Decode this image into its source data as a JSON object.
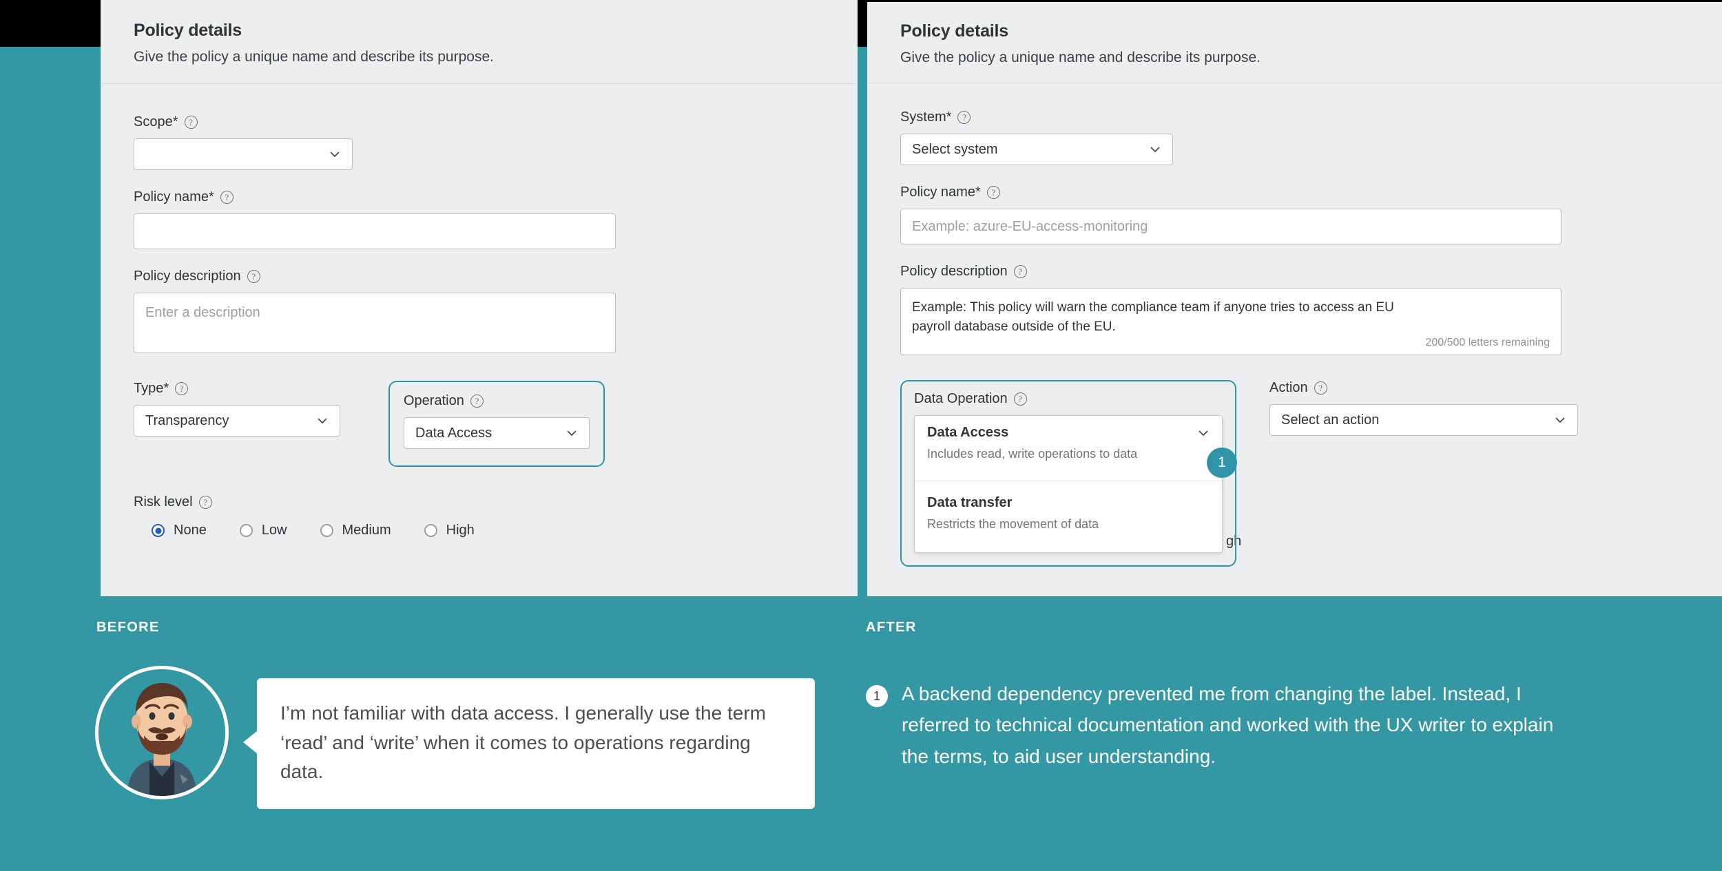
{
  "theme": {
    "background_teal": "#3498a4",
    "panel_bg": "#eceef0",
    "highlight_border": "#2f94a8",
    "radio_accent": "#1f5fbf"
  },
  "before_panel": {
    "title": "Policy details",
    "subtitle": "Give the policy a unique name and describe its purpose.",
    "scope": {
      "label": "Scope*",
      "value": ""
    },
    "policy_name": {
      "label": "Policy name*",
      "value": ""
    },
    "policy_description": {
      "label": "Policy description",
      "placeholder": "Enter a description"
    },
    "type": {
      "label": "Type*",
      "value": "Transparency"
    },
    "operation": {
      "label": "Operation",
      "value": "Data Access"
    },
    "risk_level": {
      "label": "Risk level",
      "options": [
        "None",
        "Low",
        "Medium",
        "High"
      ],
      "selected": "None"
    }
  },
  "after_panel": {
    "title": "Policy details",
    "subtitle": "Give the policy a unique name and describe its purpose.",
    "system": {
      "label": "System*",
      "value": "Select system"
    },
    "policy_name": {
      "label": "Policy name*",
      "placeholder": "Example: azure-EU-access-monitoring"
    },
    "policy_description": {
      "label": "Policy description",
      "placeholder_line1": "Example: This policy will warn the compliance team if anyone tries to access an EU",
      "placeholder_line2": "payroll database outside of the EU.",
      "counter": "200/500 letters remaining"
    },
    "data_operation": {
      "label": "Data Operation",
      "options": [
        {
          "name": "Data Access",
          "description": "Includes read, write operations to data"
        },
        {
          "name": "Data transfer",
          "description": "Restricts the movement of data"
        }
      ]
    },
    "action": {
      "label": "Action",
      "value": "Select an action"
    },
    "occluded_text": "gh",
    "marker": "1"
  },
  "captions": {
    "before": "BEFORE",
    "after": "AFTER"
  },
  "before_story": {
    "quote": "I’m not familiar with data access. I generally use the term ‘read’ and ‘write’ when it comes to operations regarding data."
  },
  "after_story": {
    "badge": "1",
    "text": "A backend dependency prevented me from changing the label. Instead, I referred to technical documentation and worked with the UX writer to explain the terms, to aid user understanding."
  },
  "icons": {
    "help": "?",
    "chevron_down": "chevron-down-icon"
  }
}
